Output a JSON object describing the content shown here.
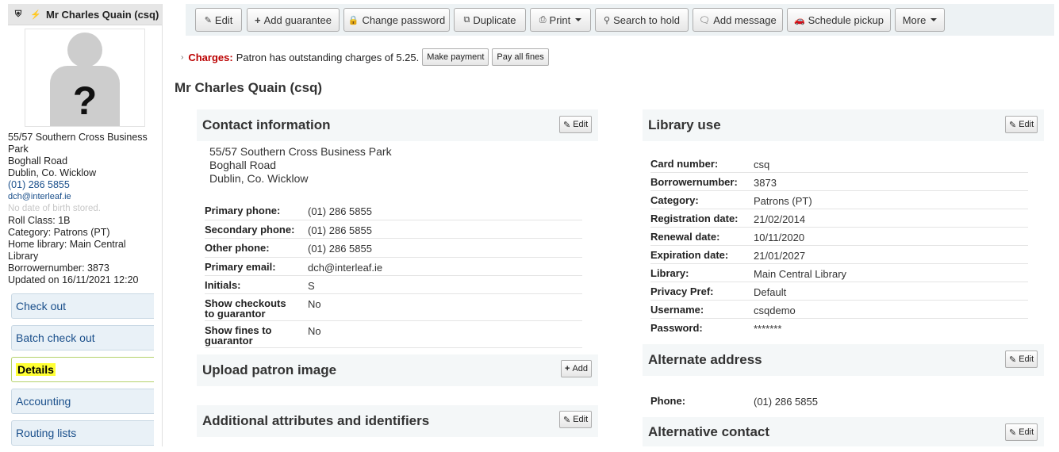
{
  "patron": {
    "header_name": "Mr Charles Quain (csq)",
    "photo_placeholder": "?",
    "address_lines": [
      "55/57 Southern Cross Business",
      "Park",
      "Boghall Road",
      "Dublin, Co. Wicklow"
    ],
    "phone": "(01) 286 5855",
    "email": "dch@interleaf.ie",
    "dob_note": "No date of birth stored.",
    "roll_class": "Roll Class: 1B",
    "category": "Category: Patrons (PT)",
    "home_library_line1": "Home library: Main Central",
    "home_library_line2": "Library",
    "borrowernumber": "Borrowernumber: 3873",
    "updated": "Updated on 16/11/2021 12:20"
  },
  "sidebar_nav": [
    "Check out",
    "Batch check out",
    "Details",
    "Accounting",
    "Routing lists"
  ],
  "toolbar": {
    "edit": "Edit",
    "add_guarantee": "Add guarantee",
    "change_password": "Change password",
    "duplicate": "Duplicate",
    "print": "Print",
    "search_to_hold": "Search to hold",
    "add_message": "Add message",
    "schedule_pickup": "Schedule pickup",
    "more": "More"
  },
  "charges": {
    "label": "Charges:",
    "text": "Patron has outstanding charges of 5.25.",
    "make_payment": "Make payment",
    "pay_all": "Pay all fines"
  },
  "page_title": "Mr Charles Quain (csq)",
  "contact": {
    "title": "Contact information",
    "edit": "Edit",
    "address": [
      "55/57 Southern Cross Business Park",
      "Boghall Road",
      "Dublin, Co. Wicklow"
    ],
    "rows": [
      {
        "label": "Primary phone:",
        "value": "(01) 286 5855",
        "link": true
      },
      {
        "label": "Secondary phone:",
        "value": "(01) 286 5855",
        "link": true
      },
      {
        "label": "Other phone:",
        "value": "(01) 286 5855",
        "link": true
      },
      {
        "label": "Primary email:",
        "value": "dch@interleaf.ie",
        "link": true
      },
      {
        "label": "Initials:",
        "value": "S",
        "link": false
      },
      {
        "label": "Show checkouts to guarantor",
        "value": "No",
        "link": false
      },
      {
        "label": "Show fines to guarantor",
        "value": "No",
        "link": false
      }
    ]
  },
  "upload_image": {
    "title": "Upload patron image",
    "add": "Add"
  },
  "additional": {
    "title": "Additional attributes and identifiers",
    "edit": "Edit"
  },
  "library_use": {
    "title": "Library use",
    "edit": "Edit",
    "rows": [
      {
        "label": "Card number:",
        "value": "csq"
      },
      {
        "label": "Borrowernumber:",
        "value": "3873"
      },
      {
        "label": "Category:",
        "value": "Patrons (PT)"
      },
      {
        "label": "Registration date:",
        "value": "21/02/2014"
      },
      {
        "label": "Renewal date:",
        "value": "10/11/2020"
      },
      {
        "label": "Expiration date:",
        "value": "21/01/2027"
      },
      {
        "label": "Library:",
        "value": "Main Central Library"
      },
      {
        "label": "Privacy Pref:",
        "value": "Default"
      },
      {
        "label": "Username:",
        "value": "csqdemo"
      },
      {
        "label": "Password:",
        "value": "*******"
      }
    ]
  },
  "alternate_address": {
    "title": "Alternate address",
    "edit": "Edit",
    "rows": [
      {
        "label": "Phone:",
        "value": "(01) 286 5855",
        "link": true
      }
    ]
  },
  "alternative_contact": {
    "title": "Alternative contact",
    "edit": "Edit"
  },
  "colors": {
    "charges_label": "#bb0000",
    "link": "#1a4f8b",
    "active_highlight": "#ffff33"
  }
}
